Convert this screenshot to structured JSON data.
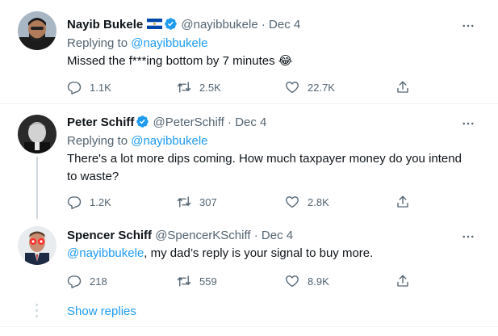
{
  "tweets": [
    {
      "name": "Nayib Bukele",
      "handle": "@nayibbukele",
      "dot": "·",
      "date": "Dec 4",
      "replying_prefix": "Replying to ",
      "replying_to": "@nayibbukele",
      "text": "Missed the f***ing bottom by 7 minutes 😂",
      "replies": "1.1K",
      "retweets": "2.5K",
      "likes": "22.7K"
    },
    {
      "name": "Peter Schiff",
      "handle": "@PeterSchiff",
      "dot": "·",
      "date": "Dec 4",
      "replying_prefix": "Replying to ",
      "replying_to": "@nayibbukele",
      "text": "There's a lot more dips coming.  How much taxpayer money do you intend to waste?",
      "replies": "1.2K",
      "retweets": "307",
      "likes": "2.8K"
    },
    {
      "name": "Spencer Schiff",
      "handle": "@SpencerKSchiff",
      "dot": "·",
      "date": "Dec 4",
      "mention": "@nayibbukele",
      "text": ", my dad’s reply is your signal to buy more.",
      "replies": "218",
      "retweets": "559",
      "likes": "8.9K"
    }
  ],
  "show_replies": "Show replies",
  "colors": {
    "accent": "#1d9bf0",
    "muted": "#536471",
    "divider": "#eff3f4",
    "thread_line": "#cfd9de"
  },
  "icons": [
    "verified-badge-icon",
    "el-salvador-flag-icon",
    "more-options-icon",
    "reply-icon",
    "retweet-icon",
    "like-icon",
    "share-icon"
  ]
}
